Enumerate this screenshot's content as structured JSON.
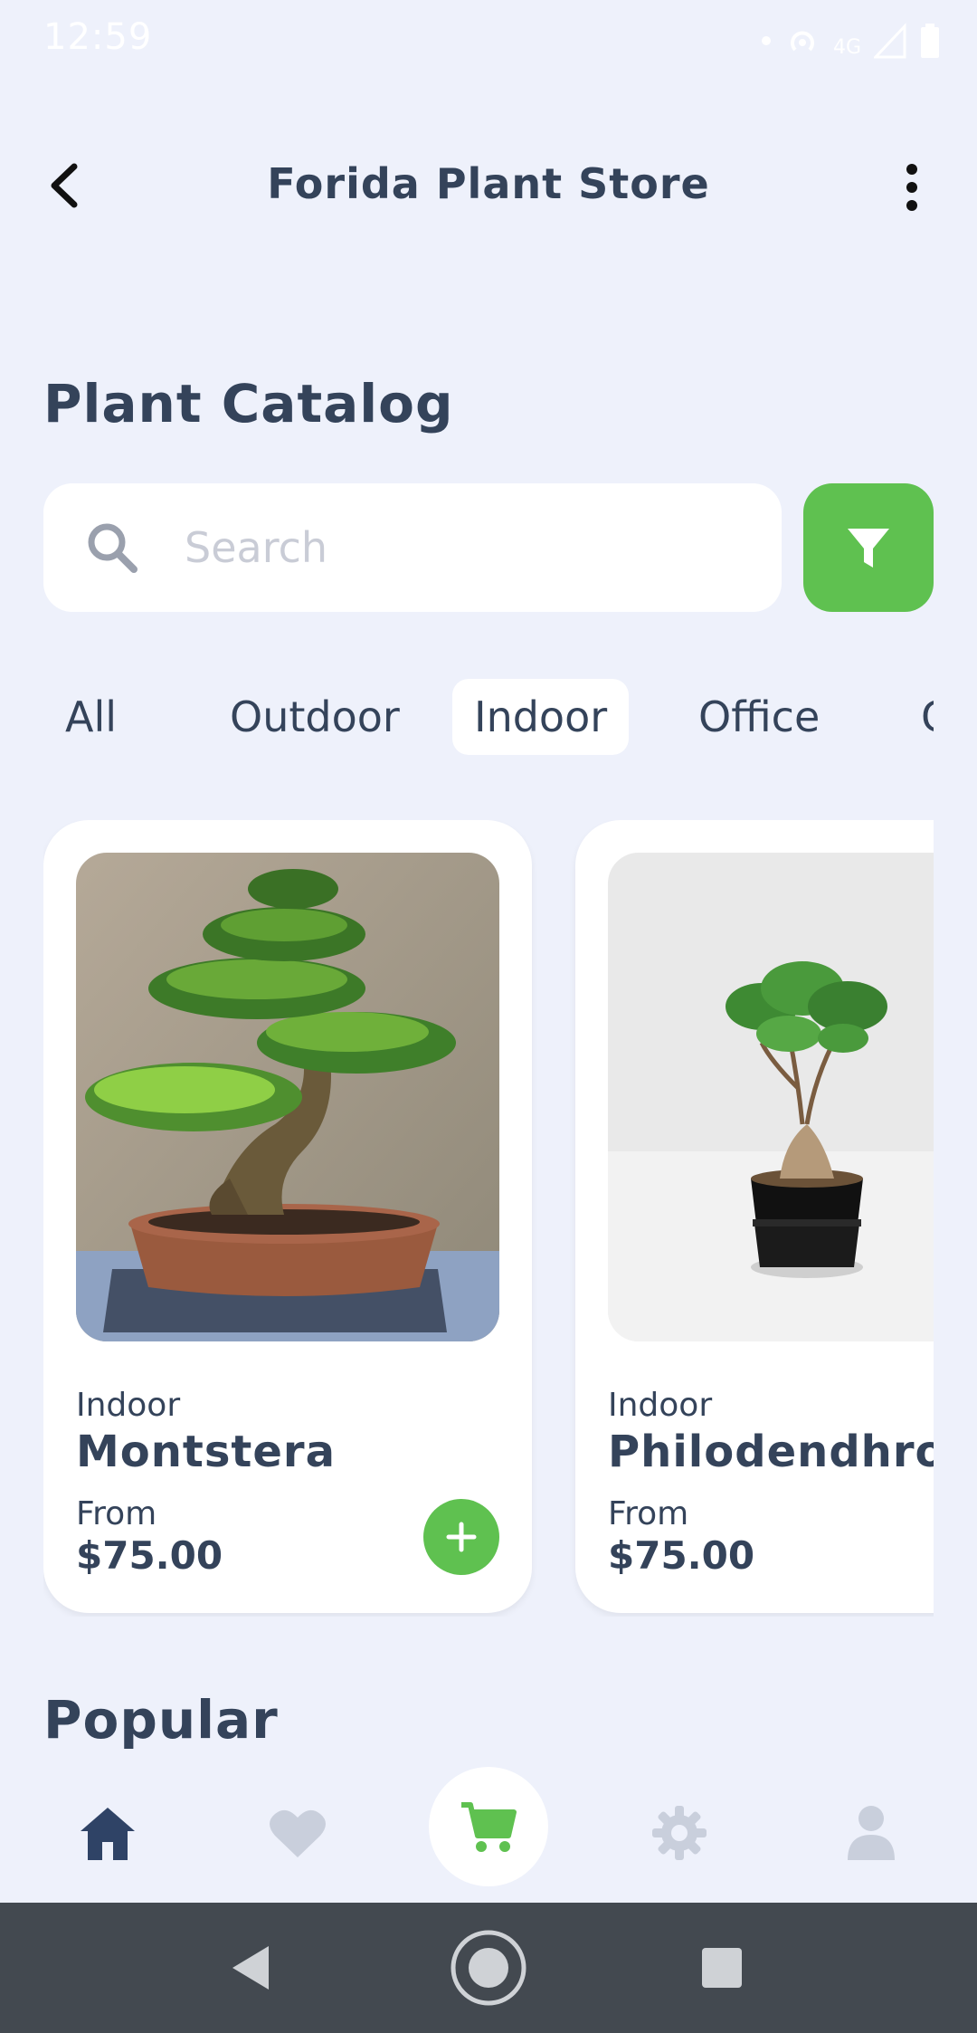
{
  "status_bar": {
    "time": "12:59",
    "network": "4G"
  },
  "header": {
    "title": "Forida Plant Store",
    "back_icon": "chevron-left-icon",
    "menu_icon": "more-vertical-icon"
  },
  "catalog": {
    "title": "Plant Catalog"
  },
  "search": {
    "placeholder": "Search",
    "value": ""
  },
  "categories": [
    "All",
    "Outdoor",
    "Indoor",
    "Office",
    "G"
  ],
  "active_category": "Indoor",
  "products": [
    {
      "category": "Indoor",
      "name": "Montstera",
      "from_label": "From",
      "price": "$75.00"
    },
    {
      "category": "Indoor",
      "name": "Philodendhron",
      "from_label": "From",
      "price": "$75.00"
    }
  ],
  "popular": {
    "title": "Popular"
  },
  "bottom_nav": [
    {
      "name": "home",
      "icon": "home-icon",
      "active": true
    },
    {
      "name": "favorites",
      "icon": "heart-icon",
      "active": false
    },
    {
      "name": "cart",
      "icon": "cart-icon",
      "active": false
    },
    {
      "name": "settings",
      "icon": "gear-icon",
      "active": false
    },
    {
      "name": "profile",
      "icon": "user-icon",
      "active": false
    }
  ],
  "colors": {
    "background": "#eef1fb",
    "accent": "#5fc150",
    "text": "#34435a",
    "system_nav": "#434950"
  }
}
